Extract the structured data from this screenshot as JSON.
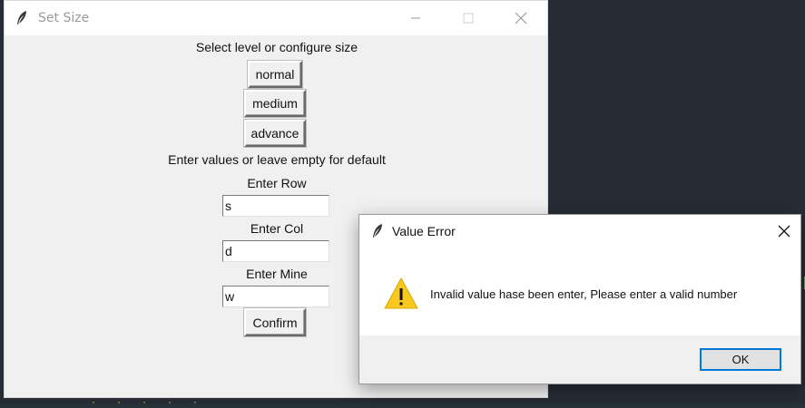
{
  "main_window": {
    "title": "Set Size",
    "heading": "Select level or configure size",
    "level_buttons": [
      "normal",
      "medium",
      "advance"
    ],
    "instructions": "Enter values or leave empty for default",
    "row_label": "Enter Row",
    "row_value": "s",
    "col_label": "Enter Col",
    "col_value": "d",
    "mine_label": "Enter Mine",
    "mine_value": "w",
    "confirm_label": "Confirm"
  },
  "dialog": {
    "title": "Value Error",
    "message": "Invalid value hase been enter, Please enter a valid number",
    "ok_label": "OK",
    "icon": "warning-icon"
  },
  "colors": {
    "accent": "#0078d7",
    "warning": "#f7c81e",
    "window_bg": "#f0f0f0",
    "desktop_bg": "#272c34"
  }
}
